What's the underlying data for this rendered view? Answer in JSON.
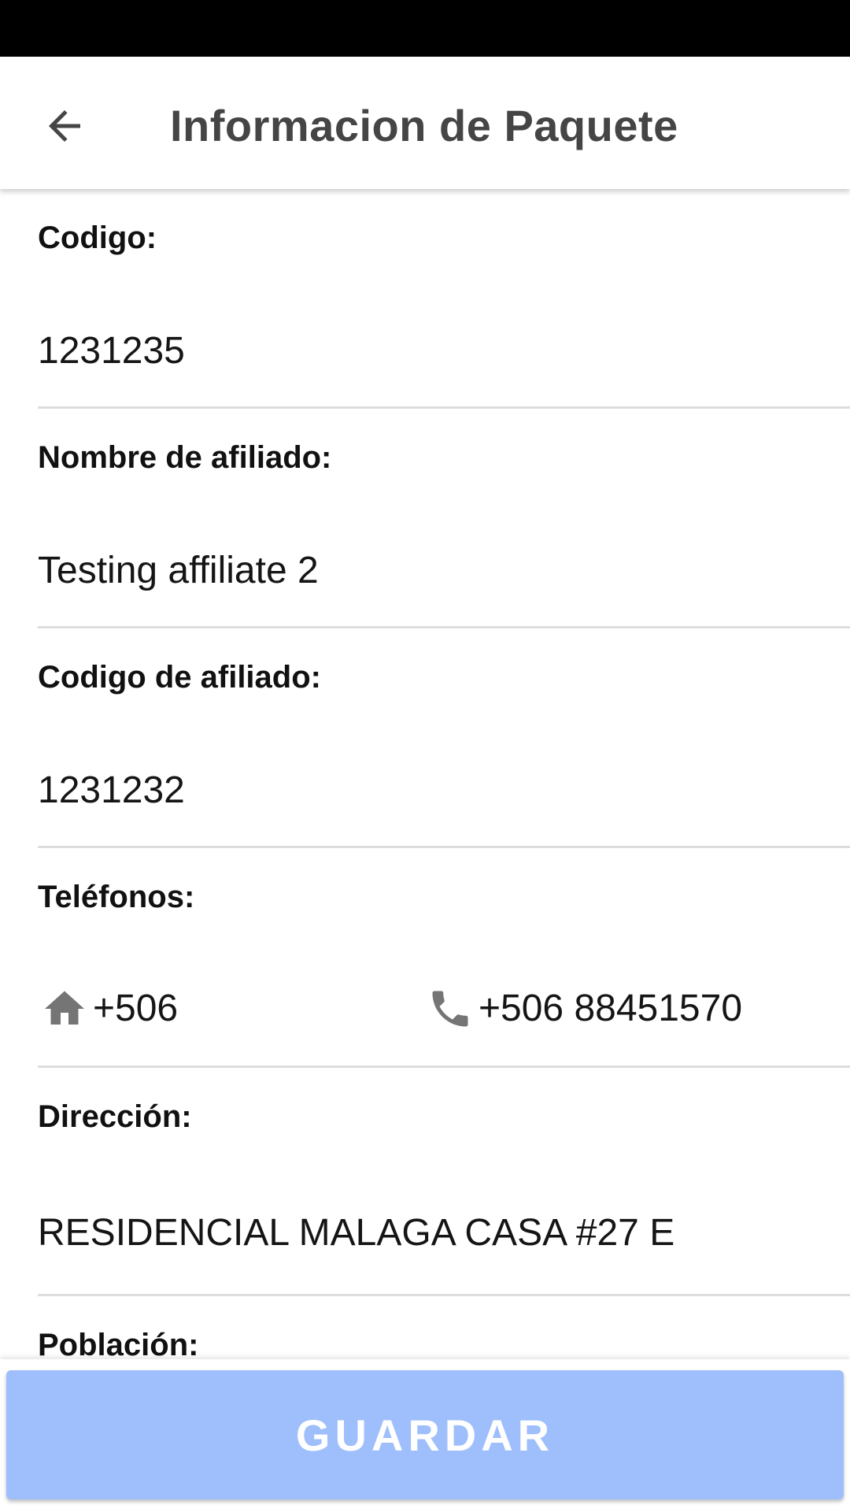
{
  "app_bar": {
    "title": "Informacion de Paquete",
    "back_icon": "arrow-back-icon"
  },
  "fields": {
    "codigo": {
      "label": "Codigo:",
      "value": "1231235"
    },
    "nombre_afiliado": {
      "label": "Nombre de afiliado:",
      "value": "Testing affiliate 2"
    },
    "codigo_afiliado": {
      "label": "Codigo de afiliado:",
      "value": "1231232"
    },
    "telefonos": {
      "label": "Teléfonos:",
      "home_icon": "home-icon",
      "home_phone": "+506",
      "mobile_icon": "phone-icon",
      "mobile_phone": "+506 88451570"
    },
    "direccion": {
      "label": "Dirección:",
      "value": "RESIDENCIAL MALAGA CASA #27 E"
    },
    "poblacion": {
      "label": "Población:"
    }
  },
  "actions": {
    "save_label": "GUARDAR"
  },
  "colors": {
    "status_bar": "#000000",
    "title": "#454545",
    "divider": "#dddddd",
    "button_bg": "#9ebffb",
    "icon": "#757575"
  }
}
